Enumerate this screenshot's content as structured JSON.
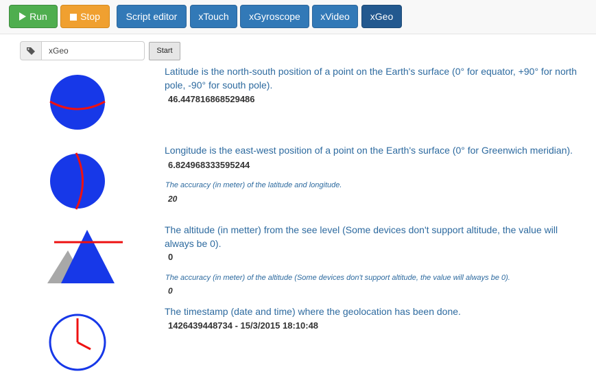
{
  "toolbar": {
    "run_label": "Run",
    "stop_label": "Stop",
    "tabs": [
      "Script editor",
      "xTouch",
      "xGyroscope",
      "xVideo",
      "xGeo"
    ],
    "active_tab": "xGeo"
  },
  "search": {
    "value": "xGeo",
    "start_label": "Start"
  },
  "latitude": {
    "description": "Latitude is the north-south position of a point on the Earth's surface (0° for equator, +90° for north pole, -90° for south pole).",
    "value": "46.447816868529486"
  },
  "longitude": {
    "description": "Longitude is the east-west position of a point on the Earth's surface (0° for Greenwich meridian).",
    "value": "6.824968333595244",
    "accuracy_description": "The accuracy (in meter) of the latitude and longitude.",
    "accuracy_value": "20"
  },
  "altitude": {
    "description": "The altitude (in metter) from the see level (Some devices don't support altitude, the value will always be 0).",
    "value": "0",
    "accuracy_description": "The accuracy (in meter) of the altitude (Some devices don't support altitude, the value will always be 0).",
    "accuracy_value": "0"
  },
  "timestamp": {
    "description": "The timestamp (date and time) where the geolocation has been done.",
    "value": "1426439448734 - 15/3/2015 18:10:48"
  },
  "colors": {
    "globe": "#1738e8",
    "marker": "#ee1111",
    "mountain_back": "#a8a8a8"
  },
  "icons": [
    "play-icon",
    "stop-icon",
    "tag-icon",
    "latitude-globe-icon",
    "longitude-globe-icon",
    "altitude-mountain-icon",
    "clock-icon"
  ]
}
